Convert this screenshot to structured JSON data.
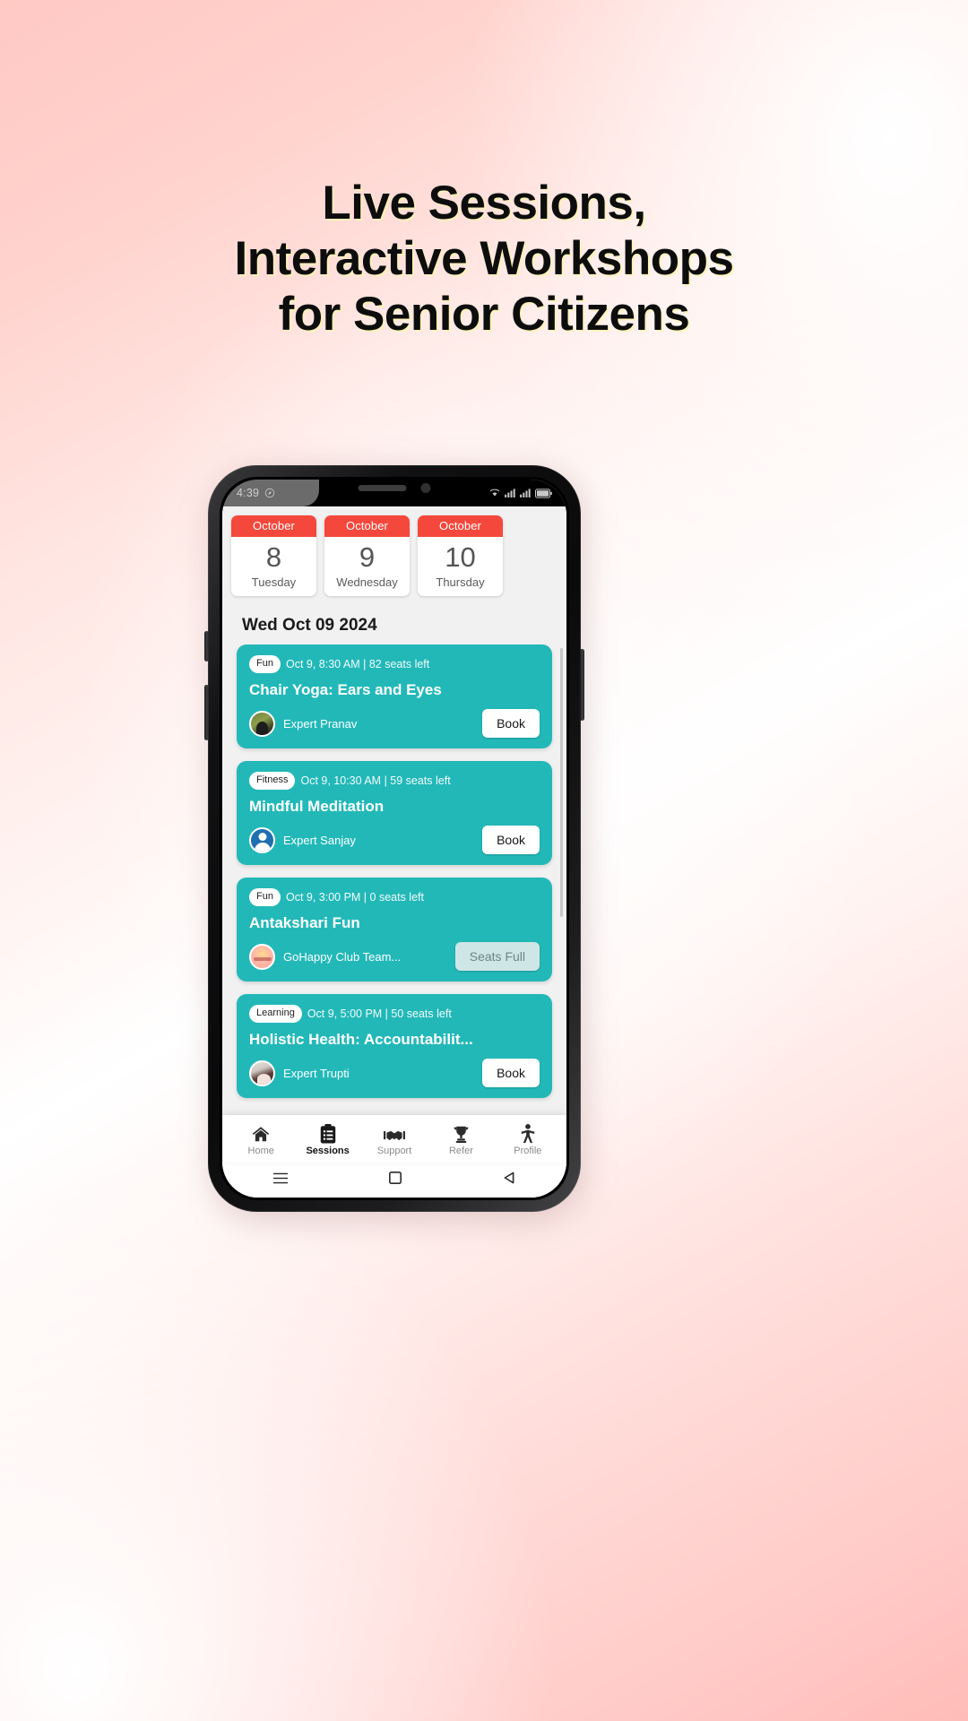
{
  "headline": {
    "line1": "Live Sessions,",
    "line2": "Interactive Workshops",
    "line3": "for Senior Citizens"
  },
  "colors": {
    "accent_teal": "#23b8b8",
    "calendar_red": "#f4483c",
    "screen_bg": "#f1f1f1",
    "card_text": "#ffffff"
  },
  "status_bar": {
    "time": "4:39",
    "left_icon": "compass-icon",
    "right_icons": [
      "wifi-icon",
      "signal-icon",
      "signal-icon",
      "battery-icon"
    ]
  },
  "date_strip": [
    {
      "month": "October",
      "day": "8",
      "weekday": "Tuesday"
    },
    {
      "month": "October",
      "day": "9",
      "weekday": "Wednesday"
    },
    {
      "month": "October",
      "day": "10",
      "weekday": "Thursday"
    }
  ],
  "day_heading": "Wed Oct 09 2024",
  "sessions": [
    {
      "tag": "Fun",
      "time": "Oct 9, 8:30 AM | 82 seats left",
      "title": "Chair Yoga: Ears and Eyes",
      "expert": "Expert Pranav",
      "avatar": "avatar-photo-pranav",
      "button": "Book",
      "sold_out": false
    },
    {
      "tag": "Fitness",
      "time": "Oct 9, 10:30 AM | 59 seats left",
      "title": "Mindful Meditation",
      "expert": "Expert Sanjay",
      "avatar": "avatar-default-sanjay",
      "button": "Book",
      "sold_out": false
    },
    {
      "tag": "Fun",
      "time": "Oct 9, 3:00 PM | 0 seats left",
      "title": "Antakshari Fun",
      "expert": "GoHappy Club Team...",
      "avatar": "avatar-logo-gohappy",
      "button": "Seats Full",
      "sold_out": true
    },
    {
      "tag": "Learning",
      "time": "Oct 9, 5:00 PM | 50 seats left",
      "title": "Holistic Health: Accountabilit...",
      "expert": "Expert Trupti",
      "avatar": "avatar-photo-trupti",
      "button": "Book",
      "sold_out": false
    }
  ],
  "bottom_nav": [
    {
      "label": "Home",
      "icon": "home-icon",
      "active": false
    },
    {
      "label": "Sessions",
      "icon": "clipboard-icon",
      "active": true
    },
    {
      "label": "Support",
      "icon": "handshake-icon",
      "active": false
    },
    {
      "label": "Refer",
      "icon": "trophy-icon",
      "active": false
    },
    {
      "label": "Profile",
      "icon": "person-icon",
      "active": false
    }
  ],
  "android_nav": {
    "recents": "menu-icon",
    "home": "square-icon",
    "back": "triangle-back-icon"
  }
}
